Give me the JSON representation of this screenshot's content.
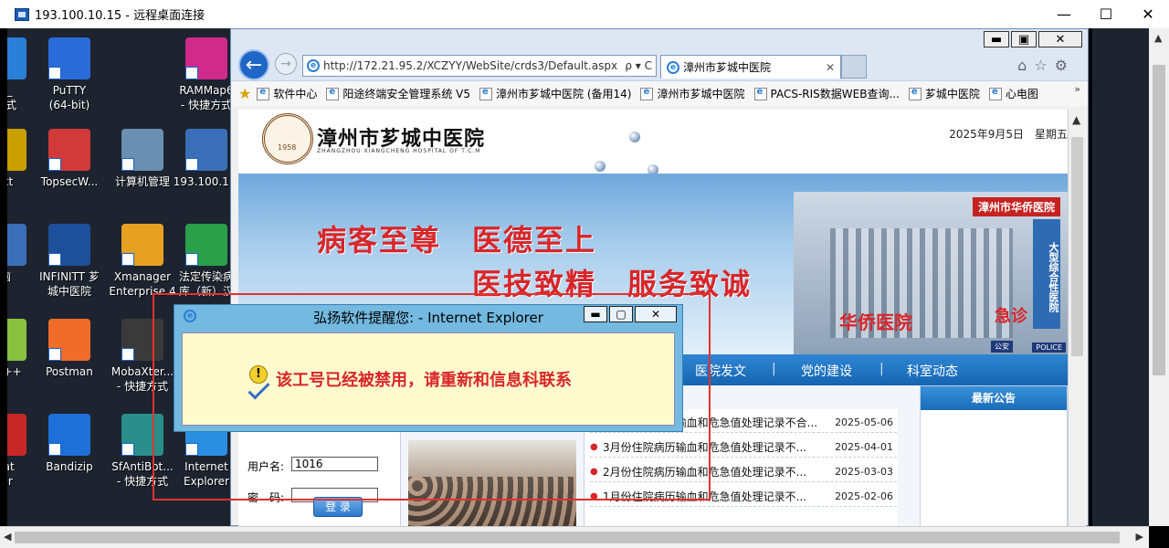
{
  "rdp": {
    "title": "193.100.10.15 - 远程桌面连接",
    "minimize": "—",
    "maximize": "☐",
    "close": "✕"
  },
  "desktop": {
    "icons": [
      {
        "label": "U_\n方式",
        "color": "#2a7fd6"
      },
      {
        "label": "PuTTY\n(64-bit)",
        "color": "#2b6bd8"
      },
      {
        "label": "RAMMap6\n- 快捷方式",
        "color": "#d02a8a"
      },
      {
        "label": "txt",
        "color": "#c8a000"
      },
      {
        "label": "TopsecW...",
        "color": "#d03a3a"
      },
      {
        "label": "计算机管理",
        "color": "#6a8fb0"
      },
      {
        "label": "193.100.1...",
        "color": "#3a6fb8"
      },
      {
        "label": "脑",
        "color": "#3a6fb8"
      },
      {
        "label": "INFINITT 芗\n城中医院",
        "color": "#1e4f9a"
      },
      {
        "label": "Xmanager\nEnterprise 4",
        "color": "#e8a020"
      },
      {
        "label": "法定传染病\n库（新）汉",
        "color": "#2aa04a"
      },
      {
        "label": "nd++",
        "color": "#8ac040"
      },
      {
        "label": "Postman",
        "color": "#ef6c2a"
      },
      {
        "label": "MobaXter...\n- 快捷方式",
        "color": "#3a3a3a"
      },
      {
        "label": "oat\nler",
        "color": "#c62828"
      },
      {
        "label": "Bandizip",
        "color": "#1e6fd8"
      },
      {
        "label": "SfAntiBot...\n- 快捷方式",
        "color": "#2a8f8a"
      },
      {
        "label": "Internet\nExplorer",
        "color": "#2a8fe0"
      }
    ]
  },
  "ie": {
    "win_min": "▬",
    "win_max": "▣",
    "win_close": "✕",
    "back": "←",
    "forward": "→",
    "url": "http://172.21.95.2/XCZYY/WebSite/crds3/Default.aspx",
    "addr_icons": "ρ ▾ C",
    "tab_title": "漳州市芗城中医院",
    "tab_close": "✕",
    "tools": "⌂☆⚙",
    "favorites": [
      "软件中心",
      "阳途终端安全管理系统 V5",
      "漳州市芗城中医院 (备用14)",
      "漳州市芗城中医院",
      "PACS-RIS数据WEB查询...",
      "芗城中医院",
      "心电图"
    ],
    "fav_more": "»"
  },
  "page": {
    "hospital_name": "漳州市芗城中医院",
    "hospital_en": "ZHANGZHOU XIANGCHENG HOSPITAL OF T.C.M",
    "date": "2025年9月5日　星期五",
    "slogan1": "病客至尊　医德至上",
    "slogan2": "医技致精　服务致诚",
    "bldg_sign": "漳州市华侨医院",
    "bldg_tower": "大型综合性医院",
    "bldg_script": "华侨医院",
    "bldg_er": "急诊",
    "gongan": "公安",
    "police": "POLICE",
    "nav": [
      "医院发文",
      "党的建设",
      "科室动态"
    ],
    "nav_sep": "|",
    "login": {
      "user_label": "用户名:",
      "user_value": "1016",
      "pass_label": "密　码:",
      "button": "登 录"
    },
    "news": [
      {
        "title": "7月份住院病历输血和危急值处理记录不合...",
        "date": "2025-05-06"
      },
      {
        "title": "3月份住院病历输血和危急值处理记录不...",
        "date": "2025-04-01"
      },
      {
        "title": "2月份住院病历输血和危急值处理记录不...",
        "date": "2025-03-03"
      },
      {
        "title": "1月份住院病历输血和危急值处理记录不...",
        "date": "2025-02-06"
      }
    ],
    "notice_title": "最新公告"
  },
  "modal": {
    "title": "弘扬软件提醒您: - Internet Explorer",
    "min": "▬",
    "max": "▢",
    "close": "✕",
    "message": "该工号已经被禁用，请重新和信息科联系"
  },
  "scroll": {
    "up": "▲",
    "left": "◀",
    "right": "▶"
  }
}
